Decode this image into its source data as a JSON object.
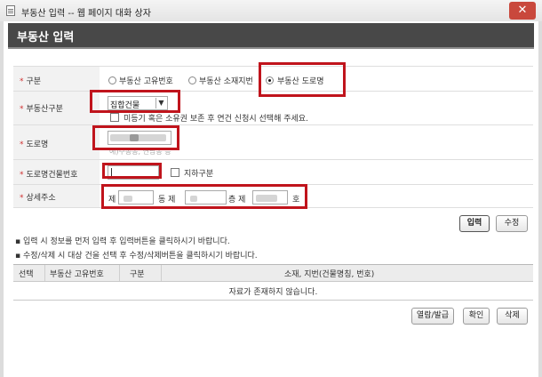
{
  "window": {
    "title": "부동산 입력 -- 웹 페이지 대화 상자",
    "close": "✕"
  },
  "header": {
    "title": "부동산 입력"
  },
  "form": {
    "type": {
      "label": "구분",
      "options": [
        "부동산 고유번호",
        "부동산 소재지번",
        "부동산 도로명"
      ],
      "selected": "부동산 도로명"
    },
    "property_type": {
      "label": "부동산구분",
      "value": "집합건물",
      "note": "미등기 혹은 소유권 보존 후 연건 신청시 선택해 주세요."
    },
    "road_name": {
      "label": "도로명",
      "value": "",
      "hint": "예)수송동, 연남동 등"
    },
    "building_no": {
      "label": "도로명건물번호",
      "value": "",
      "basement_label": "지하구분"
    },
    "detail_address": {
      "label": "상세주소",
      "parts": [
        "제",
        "동 제",
        "층 제",
        "호"
      ]
    }
  },
  "buttons": {
    "input": "입력",
    "edit": "수정",
    "view_issue": "열람/발급",
    "confirm": "확인",
    "delete": "삭제"
  },
  "notes": [
    "▪ 입력 시 정보를 먼저 입력 후 입력버튼을 클릭하시기 바랍니다.",
    "▪ 수정/삭제 시 대상 건을 선택 후 수정/삭제버튼을 클릭하시기 바랍니다."
  ],
  "table": {
    "headers": [
      "선택",
      "부동산 고유번호",
      "구분",
      "소재, 지번(건물명칭, 번호)"
    ],
    "empty_message": "자료가 존재하지 않습니다."
  },
  "colors": {
    "header_bg": "#484848",
    "highlight": "#c0141c",
    "required": "#d03030"
  }
}
